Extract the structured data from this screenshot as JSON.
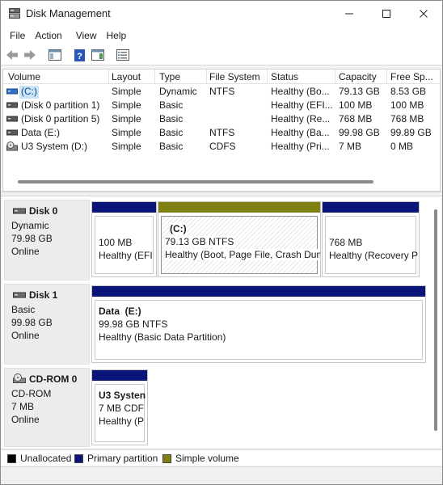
{
  "window": {
    "title": "Disk Management"
  },
  "menu": [
    {
      "label": "File"
    },
    {
      "label": "Action"
    },
    {
      "label": "View"
    },
    {
      "label": "Help"
    }
  ],
  "toolbar": {
    "icons": [
      "back-icon",
      "forward-icon",
      "show-hide-console-tree-icon",
      "help-icon",
      "show-hide-action-pane-icon",
      "properties-icon"
    ]
  },
  "volume_list": {
    "columns": [
      "Volume",
      "Layout",
      "Type",
      "File System",
      "Status",
      "Capacity",
      "Free Sp..."
    ],
    "rows": [
      {
        "volume": "(C:)",
        "layout": "Simple",
        "type": "Dynamic",
        "fs": "NTFS",
        "status": "Healthy (Bo...",
        "capacity": "79.13 GB",
        "free": "8.53 GB",
        "icon": "drive-icon",
        "selected": true
      },
      {
        "volume": "(Disk 0 partition 1)",
        "layout": "Simple",
        "type": "Basic",
        "fs": "",
        "status": "Healthy (EFI...",
        "capacity": "100 MB",
        "free": "100 MB",
        "icon": "drive-icon"
      },
      {
        "volume": "(Disk 0 partition 5)",
        "layout": "Simple",
        "type": "Basic",
        "fs": "",
        "status": "Healthy (Re...",
        "capacity": "768 MB",
        "free": "768 MB",
        "icon": "drive-icon"
      },
      {
        "volume": "Data (E:)",
        "layout": "Simple",
        "type": "Basic",
        "fs": "NTFS",
        "status": "Healthy (Ba...",
        "capacity": "99.98 GB",
        "free": "99.89 GB",
        "icon": "drive-icon"
      },
      {
        "volume": "U3 System (D:)",
        "layout": "Simple",
        "type": "Basic",
        "fs": "CDFS",
        "status": "Healthy (Pri...",
        "capacity": "7 MB",
        "free": "0 MB",
        "icon": "cdrom-icon"
      }
    ]
  },
  "disks": [
    {
      "name": "Disk 0",
      "type": "Dynamic",
      "size": "79.98 GB",
      "state": "Online",
      "partitions": [
        {
          "name": "",
          "size": "100 MB",
          "status": "Healthy (EFI",
          "bar": "primary"
        },
        {
          "name": "(C:)",
          "size": "79.13 GB NTFS",
          "status": "Healthy (Boot, Page File, Crash Dum",
          "bar": "simple",
          "selected": true
        },
        {
          "name": "",
          "size": "768 MB",
          "status": "Healthy (Recovery P",
          "bar": "primary"
        }
      ]
    },
    {
      "name": "Disk 1",
      "type": "Basic",
      "size": "99.98 GB",
      "state": "Online",
      "partitions": [
        {
          "name": "Data  (E:)",
          "size": "99.98 GB NTFS",
          "status": "Healthy (Basic Data Partition)",
          "bar": "primary"
        }
      ]
    },
    {
      "name": "CD-ROM 0",
      "type": "CD-ROM",
      "size": "7 MB",
      "state": "Online",
      "partitions": [
        {
          "name": "U3 Systen",
          "size": "7 MB CDF",
          "status": "Healthy (P",
          "bar": "primary"
        }
      ]
    }
  ],
  "legend": [
    {
      "label": "Unallocated",
      "color": "#000000"
    },
    {
      "label": "Primary partition",
      "color": "#0b1478"
    },
    {
      "label": "Simple volume",
      "color": "#7f7f12"
    }
  ]
}
